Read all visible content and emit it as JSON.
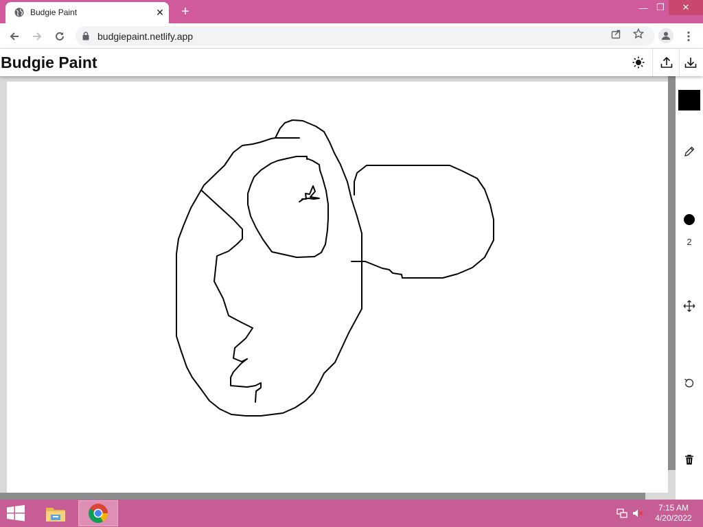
{
  "browser": {
    "tab_title": "Budgie Paint",
    "tab_close": "✕",
    "new_tab": "+",
    "url": "budgiepaint.netlify.app",
    "window_controls": {
      "minimize": "—",
      "maximize": "❐",
      "close": "✕"
    }
  },
  "app": {
    "title": "Budgie Paint",
    "header_icons": [
      "theme-toggle-icon",
      "upload-icon",
      "download-icon"
    ]
  },
  "tools": {
    "selected_color": "#000000",
    "brush_size": "2",
    "items": [
      "pencil-icon",
      "brush-size-dot",
      "move-icon",
      "undo-icon",
      "trash-icon"
    ]
  },
  "taskbar": {
    "time": "7:15 AM",
    "date": "4/20/2022",
    "apps": [
      "file-explorer-icon",
      "chrome-icon"
    ],
    "tray": [
      "network-icon",
      "volume-muted-icon"
    ]
  },
  "colors": {
    "tab_strip": "#d05a9b",
    "taskbar": "#c65d94",
    "stroke": "#000000"
  }
}
